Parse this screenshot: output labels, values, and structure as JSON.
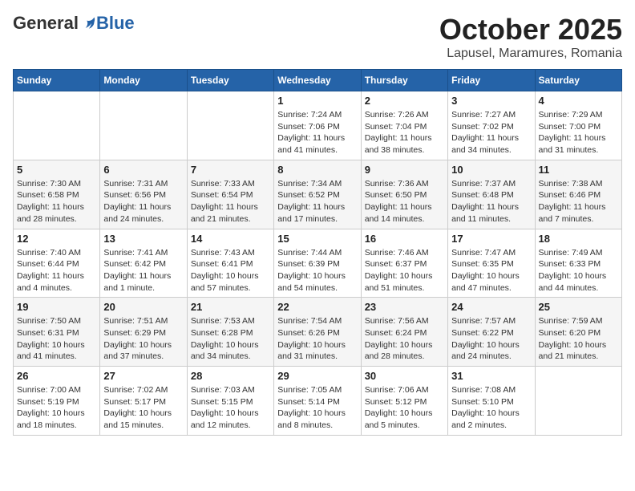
{
  "header": {
    "logo_general": "General",
    "logo_blue": "Blue",
    "month_title": "October 2025",
    "location": "Lapusel, Maramures, Romania"
  },
  "days_of_week": [
    "Sunday",
    "Monday",
    "Tuesday",
    "Wednesday",
    "Thursday",
    "Friday",
    "Saturday"
  ],
  "weeks": [
    [
      {
        "day": "",
        "info": ""
      },
      {
        "day": "",
        "info": ""
      },
      {
        "day": "",
        "info": ""
      },
      {
        "day": "1",
        "info": "Sunrise: 7:24 AM\nSunset: 7:06 PM\nDaylight: 11 hours and 41 minutes."
      },
      {
        "day": "2",
        "info": "Sunrise: 7:26 AM\nSunset: 7:04 PM\nDaylight: 11 hours and 38 minutes."
      },
      {
        "day": "3",
        "info": "Sunrise: 7:27 AM\nSunset: 7:02 PM\nDaylight: 11 hours and 34 minutes."
      },
      {
        "day": "4",
        "info": "Sunrise: 7:29 AM\nSunset: 7:00 PM\nDaylight: 11 hours and 31 minutes."
      }
    ],
    [
      {
        "day": "5",
        "info": "Sunrise: 7:30 AM\nSunset: 6:58 PM\nDaylight: 11 hours and 28 minutes."
      },
      {
        "day": "6",
        "info": "Sunrise: 7:31 AM\nSunset: 6:56 PM\nDaylight: 11 hours and 24 minutes."
      },
      {
        "day": "7",
        "info": "Sunrise: 7:33 AM\nSunset: 6:54 PM\nDaylight: 11 hours and 21 minutes."
      },
      {
        "day": "8",
        "info": "Sunrise: 7:34 AM\nSunset: 6:52 PM\nDaylight: 11 hours and 17 minutes."
      },
      {
        "day": "9",
        "info": "Sunrise: 7:36 AM\nSunset: 6:50 PM\nDaylight: 11 hours and 14 minutes."
      },
      {
        "day": "10",
        "info": "Sunrise: 7:37 AM\nSunset: 6:48 PM\nDaylight: 11 hours and 11 minutes."
      },
      {
        "day": "11",
        "info": "Sunrise: 7:38 AM\nSunset: 6:46 PM\nDaylight: 11 hours and 7 minutes."
      }
    ],
    [
      {
        "day": "12",
        "info": "Sunrise: 7:40 AM\nSunset: 6:44 PM\nDaylight: 11 hours and 4 minutes."
      },
      {
        "day": "13",
        "info": "Sunrise: 7:41 AM\nSunset: 6:42 PM\nDaylight: 11 hours and 1 minute."
      },
      {
        "day": "14",
        "info": "Sunrise: 7:43 AM\nSunset: 6:41 PM\nDaylight: 10 hours and 57 minutes."
      },
      {
        "day": "15",
        "info": "Sunrise: 7:44 AM\nSunset: 6:39 PM\nDaylight: 10 hours and 54 minutes."
      },
      {
        "day": "16",
        "info": "Sunrise: 7:46 AM\nSunset: 6:37 PM\nDaylight: 10 hours and 51 minutes."
      },
      {
        "day": "17",
        "info": "Sunrise: 7:47 AM\nSunset: 6:35 PM\nDaylight: 10 hours and 47 minutes."
      },
      {
        "day": "18",
        "info": "Sunrise: 7:49 AM\nSunset: 6:33 PM\nDaylight: 10 hours and 44 minutes."
      }
    ],
    [
      {
        "day": "19",
        "info": "Sunrise: 7:50 AM\nSunset: 6:31 PM\nDaylight: 10 hours and 41 minutes."
      },
      {
        "day": "20",
        "info": "Sunrise: 7:51 AM\nSunset: 6:29 PM\nDaylight: 10 hours and 37 minutes."
      },
      {
        "day": "21",
        "info": "Sunrise: 7:53 AM\nSunset: 6:28 PM\nDaylight: 10 hours and 34 minutes."
      },
      {
        "day": "22",
        "info": "Sunrise: 7:54 AM\nSunset: 6:26 PM\nDaylight: 10 hours and 31 minutes."
      },
      {
        "day": "23",
        "info": "Sunrise: 7:56 AM\nSunset: 6:24 PM\nDaylight: 10 hours and 28 minutes."
      },
      {
        "day": "24",
        "info": "Sunrise: 7:57 AM\nSunset: 6:22 PM\nDaylight: 10 hours and 24 minutes."
      },
      {
        "day": "25",
        "info": "Sunrise: 7:59 AM\nSunset: 6:20 PM\nDaylight: 10 hours and 21 minutes."
      }
    ],
    [
      {
        "day": "26",
        "info": "Sunrise: 7:00 AM\nSunset: 5:19 PM\nDaylight: 10 hours and 18 minutes."
      },
      {
        "day": "27",
        "info": "Sunrise: 7:02 AM\nSunset: 5:17 PM\nDaylight: 10 hours and 15 minutes."
      },
      {
        "day": "28",
        "info": "Sunrise: 7:03 AM\nSunset: 5:15 PM\nDaylight: 10 hours and 12 minutes."
      },
      {
        "day": "29",
        "info": "Sunrise: 7:05 AM\nSunset: 5:14 PM\nDaylight: 10 hours and 8 minutes."
      },
      {
        "day": "30",
        "info": "Sunrise: 7:06 AM\nSunset: 5:12 PM\nDaylight: 10 hours and 5 minutes."
      },
      {
        "day": "31",
        "info": "Sunrise: 7:08 AM\nSunset: 5:10 PM\nDaylight: 10 hours and 2 minutes."
      },
      {
        "day": "",
        "info": ""
      }
    ]
  ]
}
